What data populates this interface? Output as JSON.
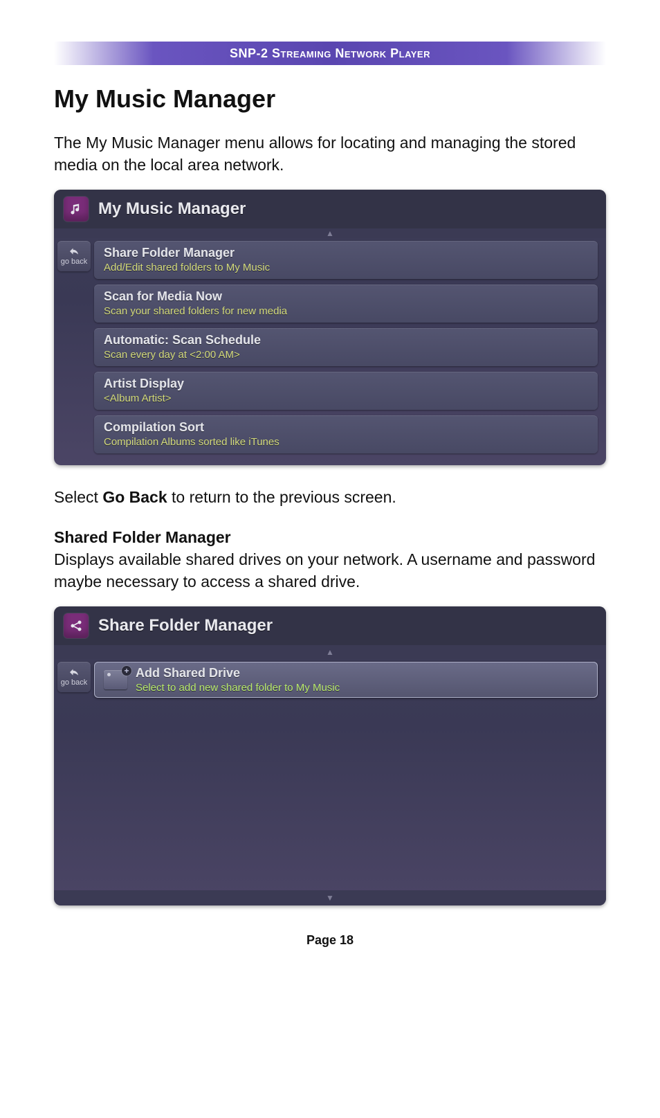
{
  "header": {
    "title": "SNP-2 Streaming Network Player"
  },
  "section": {
    "heading": "My Music Manager",
    "intro": "The My Music Manager menu allows for locating and managing the stored media on the local area network.",
    "goback_instruction_pre": "Select ",
    "goback_instruction_bold": "Go Back",
    "goback_instruction_post": " to return to the previous screen.",
    "sub_heading": "Shared Folder Manager",
    "sub_body": "Displays available shared drives on your network. A username and password maybe necessary to access a shared drive."
  },
  "panel1": {
    "title": "My Music Manager",
    "go_back_label": "go back",
    "items": [
      {
        "title": "Share Folder Manager",
        "sub": "Add/Edit shared folders to My Music"
      },
      {
        "title": "Scan for Media Now",
        "sub": "Scan your shared folders for new media"
      },
      {
        "title": "Automatic: Scan Schedule",
        "sub": "Scan every day at <2:00 AM>"
      },
      {
        "title": "Artist Display",
        "sub": "<Album Artist>"
      },
      {
        "title": "Compilation Sort",
        "sub": "Compilation Albums sorted like iTunes"
      }
    ]
  },
  "panel2": {
    "title": "Share Folder Manager",
    "go_back_label": "go back",
    "item": {
      "title": "Add Shared Drive",
      "sub": "Select to add new shared folder to My Music"
    }
  },
  "footer": {
    "page_label": "Page 18"
  }
}
